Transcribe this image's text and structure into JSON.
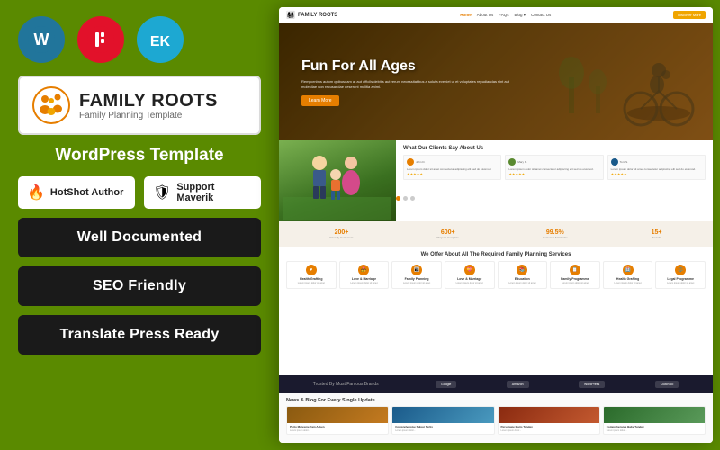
{
  "left": {
    "icons": {
      "wordpress": "W",
      "elementor": "E",
      "ek": "EK"
    },
    "brand": {
      "name": "FAMILY ROOTS",
      "tagline": "Family Planning Template"
    },
    "wp_template": "WordPress Template",
    "badges": {
      "hotshot": {
        "icon": "🔥",
        "text": "HotShot Author"
      },
      "support": {
        "icon": "🛡",
        "text": "Support Maverik"
      }
    },
    "features": [
      "Well Documented",
      "SEO Friendly",
      "Translate Press Ready"
    ]
  },
  "right": {
    "nav": {
      "logo": "FAMILY ROOTS",
      "links": [
        "Home",
        "About Us",
        "FAQs",
        "Blog",
        "Contact Us"
      ],
      "active": "Home",
      "cta": "Discover More"
    },
    "hero": {
      "title": "Fun For All Ages",
      "text": "Rempornbus autom quibusdam at aut officils debitis aut rerum necessitatibus a soluta eveniet ut et voluptates repudiandas sint aut molestiae non recusandae deserunt molitia animi.",
      "btn": "Learn More"
    },
    "testimonials_section": {
      "title": "What Our Clients Say About Us"
    },
    "stats": [
      {
        "num": "200+",
        "label": "Friendly Customers"
      },
      {
        "num": "600+",
        "label": "Projects Complete"
      },
      {
        "num": "99.5%",
        "label": "Customer Satisfactio"
      },
      {
        "num": "15+",
        "label": "Awards"
      }
    ],
    "services": {
      "title": "We Offer About All The Required Family Planning Services",
      "cards": [
        {
          "title": "Health Grafting",
          "text": "Lorem ipsum dolor sit amet"
        },
        {
          "title": "Love & Marriage",
          "text": "Lorem ipsum dolor sit amet"
        },
        {
          "title": "Family Planning",
          "text": "Lorem ipsum dolor sit amet"
        },
        {
          "title": "Love & Marriage",
          "text": "Lorem ipsum dolor sit amet"
        },
        {
          "title": "Education",
          "text": "Lorem ipsum dolor sit amet"
        },
        {
          "title": "Family Programme",
          "text": "Lorem ipsum dolor sit amet"
        },
        {
          "title": "Health Grafting",
          "text": "Lorem ipsum dolor sit amet"
        },
        {
          "title": "Legal Programme",
          "text": "Lorem ipsum dolor sit amet"
        }
      ]
    },
    "brands": {
      "title": "Trusted By Must Famous Brands",
      "items": [
        "Google",
        "Amazon",
        "WordPress",
        "Clutch.co"
      ]
    },
    "blog": {
      "title": "News & Blog For Every Single Update",
      "cards": [
        {
          "headline": "Porto Maresme Fam Adven",
          "text": "Lorem ipsum dolor..."
        },
        {
          "headline": "Comprehensive Sulpur Tertix",
          "text": "Lorem ipsum dolor..."
        },
        {
          "headline": "Persorasie Maris Tundex",
          "text": "Lorem ipsum dolor..."
        },
        {
          "headline": "Comprehensive Baby Tundex",
          "text": "Lorem ipsum dolor..."
        }
      ]
    }
  }
}
